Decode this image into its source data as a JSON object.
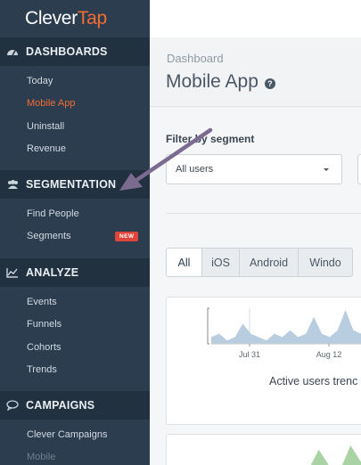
{
  "brand": {
    "part1": "Clever",
    "part2": "Tap"
  },
  "sidebar": {
    "sections": [
      {
        "label": "DASHBOARDS",
        "icon": "dashboard-icon",
        "items": [
          {
            "label": "Today",
            "active": false
          },
          {
            "label": "Mobile App",
            "active": true
          },
          {
            "label": "Uninstall",
            "active": false
          },
          {
            "label": "Revenue",
            "active": false
          }
        ]
      },
      {
        "label": "SEGMENTATION",
        "icon": "users-icon",
        "items": [
          {
            "label": "Find People",
            "active": false
          },
          {
            "label": "Segments",
            "active": false,
            "badge": "NEW"
          }
        ]
      },
      {
        "label": "ANALYZE",
        "icon": "line-chart-icon",
        "items": [
          {
            "label": "Events"
          },
          {
            "label": "Funnels"
          },
          {
            "label": "Cohorts"
          },
          {
            "label": "Trends"
          }
        ]
      },
      {
        "label": "CAMPAIGNS",
        "icon": "chat-bubble-icon",
        "items": [
          {
            "label": "Clever Campaigns"
          },
          {
            "label": "Mobile"
          }
        ]
      }
    ]
  },
  "header": {
    "breadcrumb": "Dashboard",
    "title": "Mobile App"
  },
  "filter": {
    "label": "Filter by segment",
    "selected": "All users"
  },
  "tabs": [
    {
      "label": "All",
      "active": true
    },
    {
      "label": "iOS",
      "active": false
    },
    {
      "label": "Android",
      "active": false
    },
    {
      "label": "Windo",
      "active": false
    }
  ],
  "chart_data": {
    "type": "area",
    "title": "Active users trenc",
    "x_tick_labels": [
      "Jul 31",
      "Aug 12"
    ],
    "series": [
      {
        "values": [
          2,
          3,
          1,
          2,
          6,
          3,
          2,
          1,
          3,
          2,
          4,
          2,
          3,
          8,
          3,
          2,
          4,
          10,
          4,
          3,
          5,
          4
        ]
      }
    ],
    "color": "#b9cde0"
  },
  "chart2_data": {
    "type": "area",
    "series": [
      {
        "values": [
          0,
          1,
          0,
          5,
          1,
          0,
          6,
          2,
          4
        ]
      }
    ],
    "color": "#a9d3a5"
  },
  "colors": {
    "sidebar": "#2c3d4f",
    "accent": "#f36c32",
    "badge": "#e0453b",
    "arrow": "#7b6b90"
  }
}
